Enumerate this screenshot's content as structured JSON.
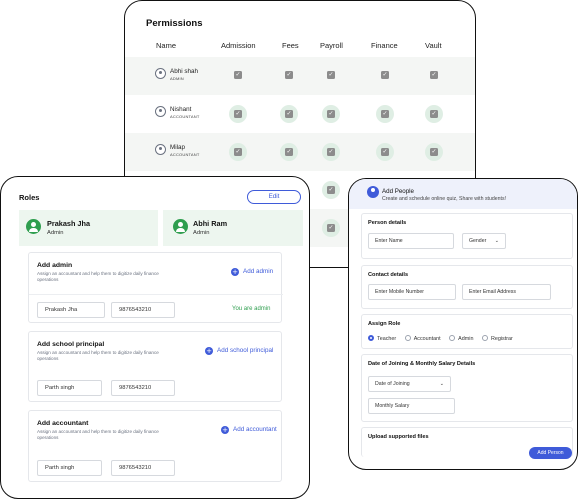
{
  "permissions": {
    "title": "Permissions",
    "columns": [
      "Name",
      "Admission",
      "Fees",
      "Payroll",
      "Finance",
      "Vault"
    ],
    "rows": [
      {
        "name": "Abhi shah",
        "role": "ADMIN"
      },
      {
        "name": "Nishant",
        "role": "ACCOUNTANT"
      },
      {
        "name": "Milap",
        "role": "ACCOUNTANT"
      }
    ],
    "check_glyph": "✓"
  },
  "roles": {
    "title": "Roles",
    "edit_label": "Edit",
    "people": [
      {
        "name": "Prakash Jha",
        "role": "Admin"
      },
      {
        "name": "Abhi Ram",
        "role": "Admin"
      }
    ],
    "sections": [
      {
        "title": "Add admin",
        "desc": "Assign an accountant and help them to digitize daily finance operations",
        "link": "Add admin",
        "name_value": "Prakash Jha",
        "phone_value": "9876543210",
        "status": "You are admin"
      },
      {
        "title": "Add school principal",
        "desc": "Assign an accountant and help them to digitize daily finance operations",
        "link": "Add school principal",
        "name_value": "Parth singh",
        "phone_value": "9876543210"
      },
      {
        "title": "Add accountant",
        "desc": "Assign an accountant and help them to digitize daily finance operations",
        "link": "Add accountant",
        "name_value": "Parth singh",
        "phone_value": "9876543210"
      }
    ]
  },
  "add_people": {
    "title": "Add People",
    "subtitle": "Create and schedule online quiz, Share with students!",
    "person_details": {
      "title": "Person details",
      "name_placeholder": "Enter Name",
      "gender": "Gender"
    },
    "contact_details": {
      "title": "Contact details",
      "mobile_placeholder": "Enter Mobile Number",
      "email_placeholder": "Enter Email Address"
    },
    "assign_role": {
      "title": "Assign Role",
      "options": [
        "Teacher",
        "Accountant",
        "Admin",
        "Registrar"
      ],
      "selected": "Teacher"
    },
    "joining": {
      "title": "Date of Joining & Monthly Salary Details",
      "date_placeholder": "Date of Joining",
      "salary_placeholder": "Monthly Salary"
    },
    "upload": {
      "title": "Upload supported files"
    },
    "submit_label": "Add Person"
  },
  "colors": {
    "accent": "#3f5bd9",
    "success": "#2f9e4f",
    "row_alt": "#f4f6f4",
    "role_box": "#edf6ef"
  }
}
